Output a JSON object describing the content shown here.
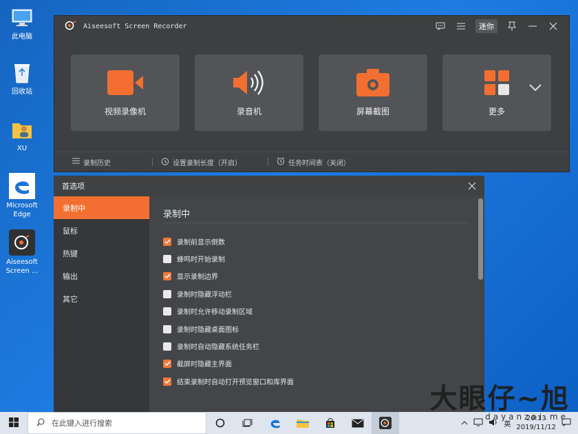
{
  "desktop": {
    "icons": [
      {
        "label": "此电脑",
        "icon": "computer-icon"
      },
      {
        "label": "回收站",
        "icon": "recycle-bin-icon"
      },
      {
        "label": "XU",
        "icon": "user-folder-icon"
      },
      {
        "label": "Microsoft Edge",
        "icon": "edge-icon"
      },
      {
        "label": "Aiseesoft Screen ...",
        "icon": "aiseesoft-app-icon"
      }
    ]
  },
  "recorder": {
    "title": "Aiseesoft Screen Recorder",
    "mini_label": "迷你",
    "tiles": [
      {
        "label": "视频录像机",
        "icon": "video-camera-icon"
      },
      {
        "label": "录音机",
        "icon": "speaker-icon"
      },
      {
        "label": "屏幕截图",
        "icon": "screenshot-camera-icon"
      },
      {
        "label": "更多",
        "icon": "grid-icon"
      }
    ],
    "bottom": {
      "history": "录制历史",
      "length": "设置录制长度（开启）",
      "schedule": "任务时间表（关闭）"
    },
    "colors": {
      "accent": "#f26f31",
      "window": "#3d3f41",
      "tile": "#525457"
    }
  },
  "prefs": {
    "title": "首选项",
    "sidebar": [
      "录制中",
      "鼠标",
      "热键",
      "输出",
      "其它"
    ],
    "active_index": 0,
    "section_title": "录制中",
    "options": [
      {
        "label": "录制前显示倒数",
        "checked": true
      },
      {
        "label": "蜂鸣时开始录制",
        "checked": false
      },
      {
        "label": "显示录制边界",
        "checked": true
      },
      {
        "label": "录制时隐藏浮动栏",
        "checked": false
      },
      {
        "label": "录制时允许移动录制区域",
        "checked": false
      },
      {
        "label": "录制时隐藏桌面图标",
        "checked": false
      },
      {
        "label": "录制时自动隐藏系统任务栏",
        "checked": false
      },
      {
        "label": "截屏时隐藏主界面",
        "checked": true
      },
      {
        "label": "结束录制时自动打开预览窗口和库界面",
        "checked": true
      }
    ]
  },
  "taskbar": {
    "search_placeholder": "在此键入进行搜索",
    "ime": "英",
    "time": "20:13",
    "date": "2019/11/12"
  },
  "watermark": {
    "main": "大眼仔~旭",
    "sub": "dayanzai.me"
  }
}
